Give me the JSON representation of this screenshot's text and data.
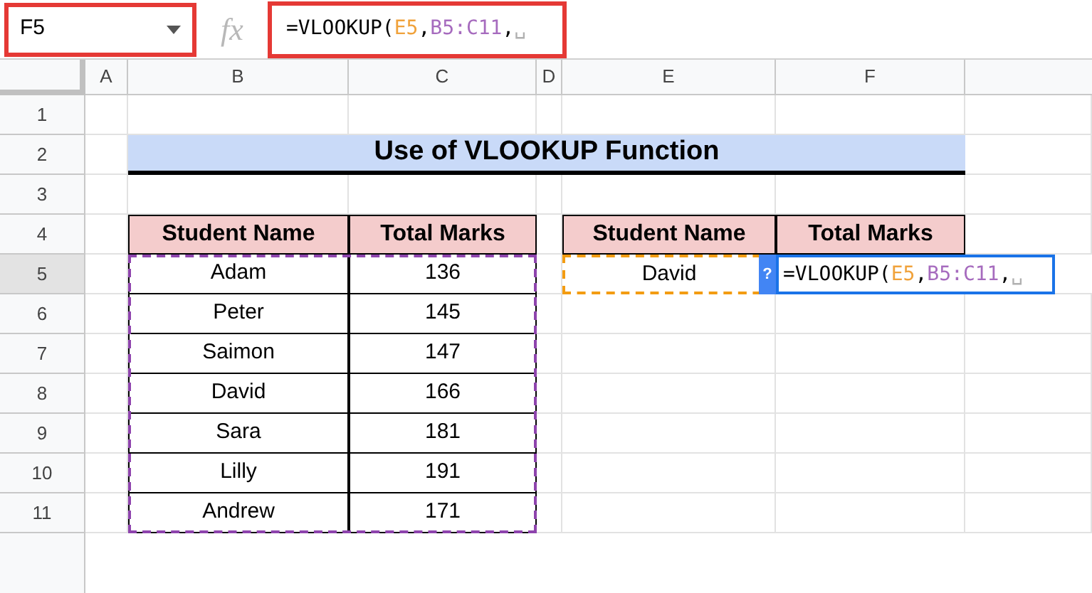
{
  "name_box": {
    "value": "F5"
  },
  "formula_bar": {
    "icon": "fx",
    "segments": [
      {
        "text": "=VLOOKUP("
      },
      {
        "text": "E5",
        "color": "#f0a23b"
      },
      {
        "text": ","
      },
      {
        "text": "B5:C11",
        "color": "#a66bbe"
      },
      {
        "text": ","
      },
      {
        "text": "␣",
        "color": "#b0b0b0"
      }
    ]
  },
  "column_headers": [
    {
      "label": "A",
      "selected": false
    },
    {
      "label": "B",
      "selected": false
    },
    {
      "label": "C",
      "selected": false
    },
    {
      "label": "D",
      "selected": false
    },
    {
      "label": "E",
      "selected": false
    },
    {
      "label": "F",
      "selected": false
    }
  ],
  "row_headers": [
    {
      "label": "1",
      "selected": false
    },
    {
      "label": "2",
      "selected": false
    },
    {
      "label": "3",
      "selected": false
    },
    {
      "label": "4",
      "selected": false
    },
    {
      "label": "5",
      "selected": true
    },
    {
      "label": "6",
      "selected": false
    },
    {
      "label": "7",
      "selected": false
    },
    {
      "label": "8",
      "selected": false
    },
    {
      "label": "9",
      "selected": false
    },
    {
      "label": "10",
      "selected": false
    },
    {
      "label": "11",
      "selected": false
    }
  ],
  "title": "Use of VLOOKUP Function",
  "source_table": {
    "columns": [
      "Student Name",
      "Total Marks"
    ],
    "rows": [
      [
        "Adam",
        "136"
      ],
      [
        "Peter",
        "145"
      ],
      [
        "Saimon",
        "147"
      ],
      [
        "David",
        "166"
      ],
      [
        "Sara",
        "181"
      ],
      [
        "Lilly",
        "191"
      ],
      [
        "Andrew",
        "171"
      ]
    ]
  },
  "lookup_table": {
    "columns": [
      "Student Name",
      "Total Marks"
    ],
    "rows": [
      [
        "David"
      ]
    ]
  },
  "cell_editor": {
    "help": "?",
    "segments": [
      {
        "text": "=VLOOKUP("
      },
      {
        "text": "E5",
        "color": "#f0a23b"
      },
      {
        "text": ","
      },
      {
        "text": "B5:C11",
        "color": "#a66bbe"
      },
      {
        "text": ","
      },
      {
        "text": "␣",
        "color": "#b0b0b0"
      }
    ]
  }
}
